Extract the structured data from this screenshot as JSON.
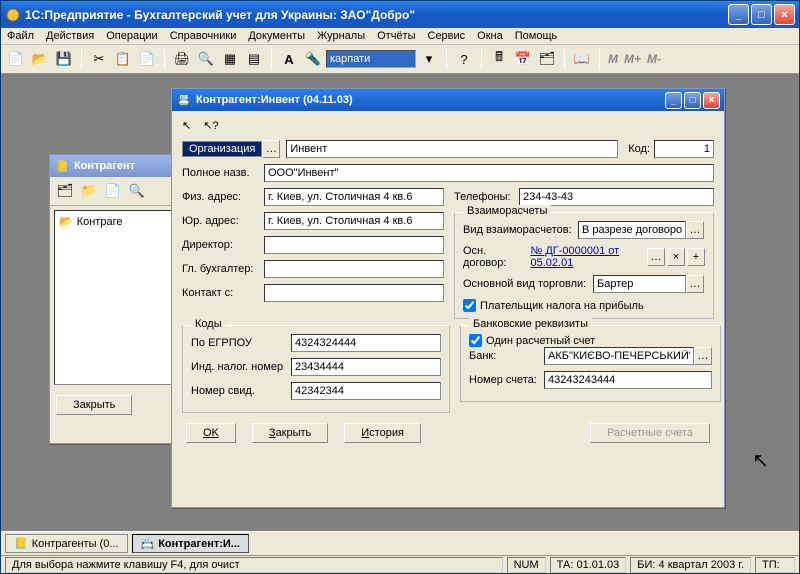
{
  "app": {
    "title": "1С:Предприятие - Бухгалтерский учет для Украины: ЗАО\"Добро\""
  },
  "menu": {
    "file": "Файл",
    "actions": "Действия",
    "operations": "Операции",
    "references": "Справочники",
    "documents": "Документы",
    "journals": "Журналы",
    "reports": "Отчёты",
    "service": "Сервис",
    "windows": "Окна",
    "help": "Помощь"
  },
  "toolbar": {
    "search_value": "карпати",
    "m": "M",
    "mplus": "M+",
    "mminus": "M-"
  },
  "back_window": {
    "title": "Контрагент",
    "tree_item": "Контраге",
    "close_btn": "Закрыть"
  },
  "front": {
    "title": "Контрагент:Инвент (04.11.03)",
    "type_box": "Организация",
    "name": "Инвент",
    "code_label": "Код:",
    "code_value": "1",
    "fullname_label": "Полное назв.",
    "fullname_value": "ООО\"Инвент\"",
    "phys_addr_label": "Физ. адрес:",
    "phys_addr_value": "г. Киев, ул. Столичная 4 кв.6",
    "phones_label": "Телефоны:",
    "phones_value": "234-43-43",
    "legal_addr_label": "Юр. адрес:",
    "legal_addr_value": "г. Киев, ул. Столичная 4 кв.6",
    "director_label": "Директор:",
    "director_value": "",
    "accountant_label": "Гл. бухгалтер:",
    "accountant_value": "",
    "contact_label": "Контакт с:",
    "contact_value": "",
    "settlements": {
      "group": "Взаиморасчеты",
      "kind_label": "Вид взаиморасчетов:",
      "kind_value": "В разрезе договоров",
      "main_contract_label": "Осн. договор:",
      "main_contract_link": "№ ДГ-0000001 от 05.02.01",
      "trade_label": "Основной вид торговли:",
      "trade_value": "Бартер",
      "taxpayer": "Плательщик налога на прибыль"
    },
    "codes": {
      "group": "Коды",
      "egrpou_label": "По ЕГРПОУ",
      "egrpou_value": "4324324444",
      "inn_label": "Инд. налог. номер",
      "inn_value": "23434444",
      "cert_label": "Номер свид.",
      "cert_value": "42342344"
    },
    "bank": {
      "group": "Банковские реквизиты",
      "single_account": "Один расчетный счет",
      "bank_label": "Банк:",
      "bank_value": "АКБ\"КИЄВО-ПЕЧЕРСЬКИЙ\"",
      "account_label": "Номер счета:",
      "account_value": "43243243444"
    },
    "buttons": {
      "ok": "OK",
      "close": "Закрыть",
      "history": "История",
      "accounts": "Расчетные счета"
    }
  },
  "taskbar": {
    "item1": "Контрагенты (0...",
    "item2": "Контрагент:И..."
  },
  "status": {
    "hint": "Для выбора нажмите клавишу F4, для очист",
    "num": "NUM",
    "ta": "ТА: 01.01.03",
    "bi": "БИ: 4 квартал 2003 г.",
    "tp": "ТП:"
  }
}
